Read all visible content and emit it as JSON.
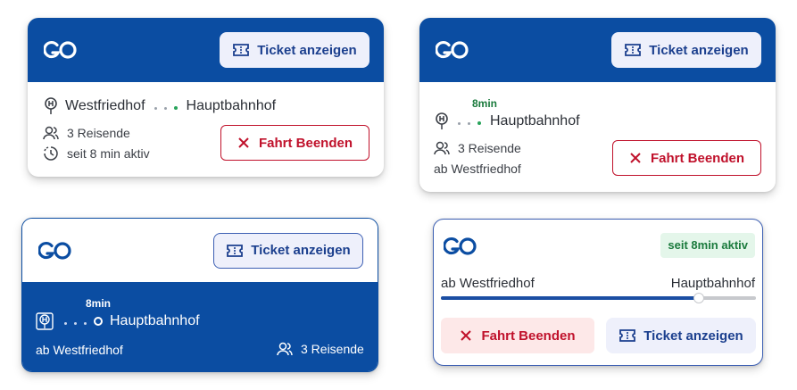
{
  "logo_text": "GO",
  "ticket_label": "Ticket anzeigen",
  "end_label": "Fahrt Beenden",
  "card1": {
    "from": "Westfriedhof",
    "to": "Hauptbahnhof",
    "travelers": "3 Reisende",
    "active": "seit 8 min aktiv"
  },
  "card2": {
    "minutes": "8min",
    "to": "Hauptbahnhof",
    "travelers": "3 Reisende",
    "from": "ab Westfriedhof"
  },
  "card3": {
    "minutes": "8min",
    "to": "Hauptbahnhof",
    "from": "ab Westfriedhof",
    "travelers": "3 Reisende"
  },
  "card4": {
    "active_badge": "seit 8min aktiv",
    "from": "ab Westfriedhof",
    "to": "Hauptbahnhof",
    "progress": 0.82
  },
  "colors": {
    "brand_blue": "#0b4da2",
    "danger_red": "#c0112b",
    "success_green": "#1a7a3c"
  },
  "icons": [
    "go-logo",
    "ticket-icon",
    "close-icon",
    "station-icon",
    "users-icon",
    "clock-icon"
  ]
}
